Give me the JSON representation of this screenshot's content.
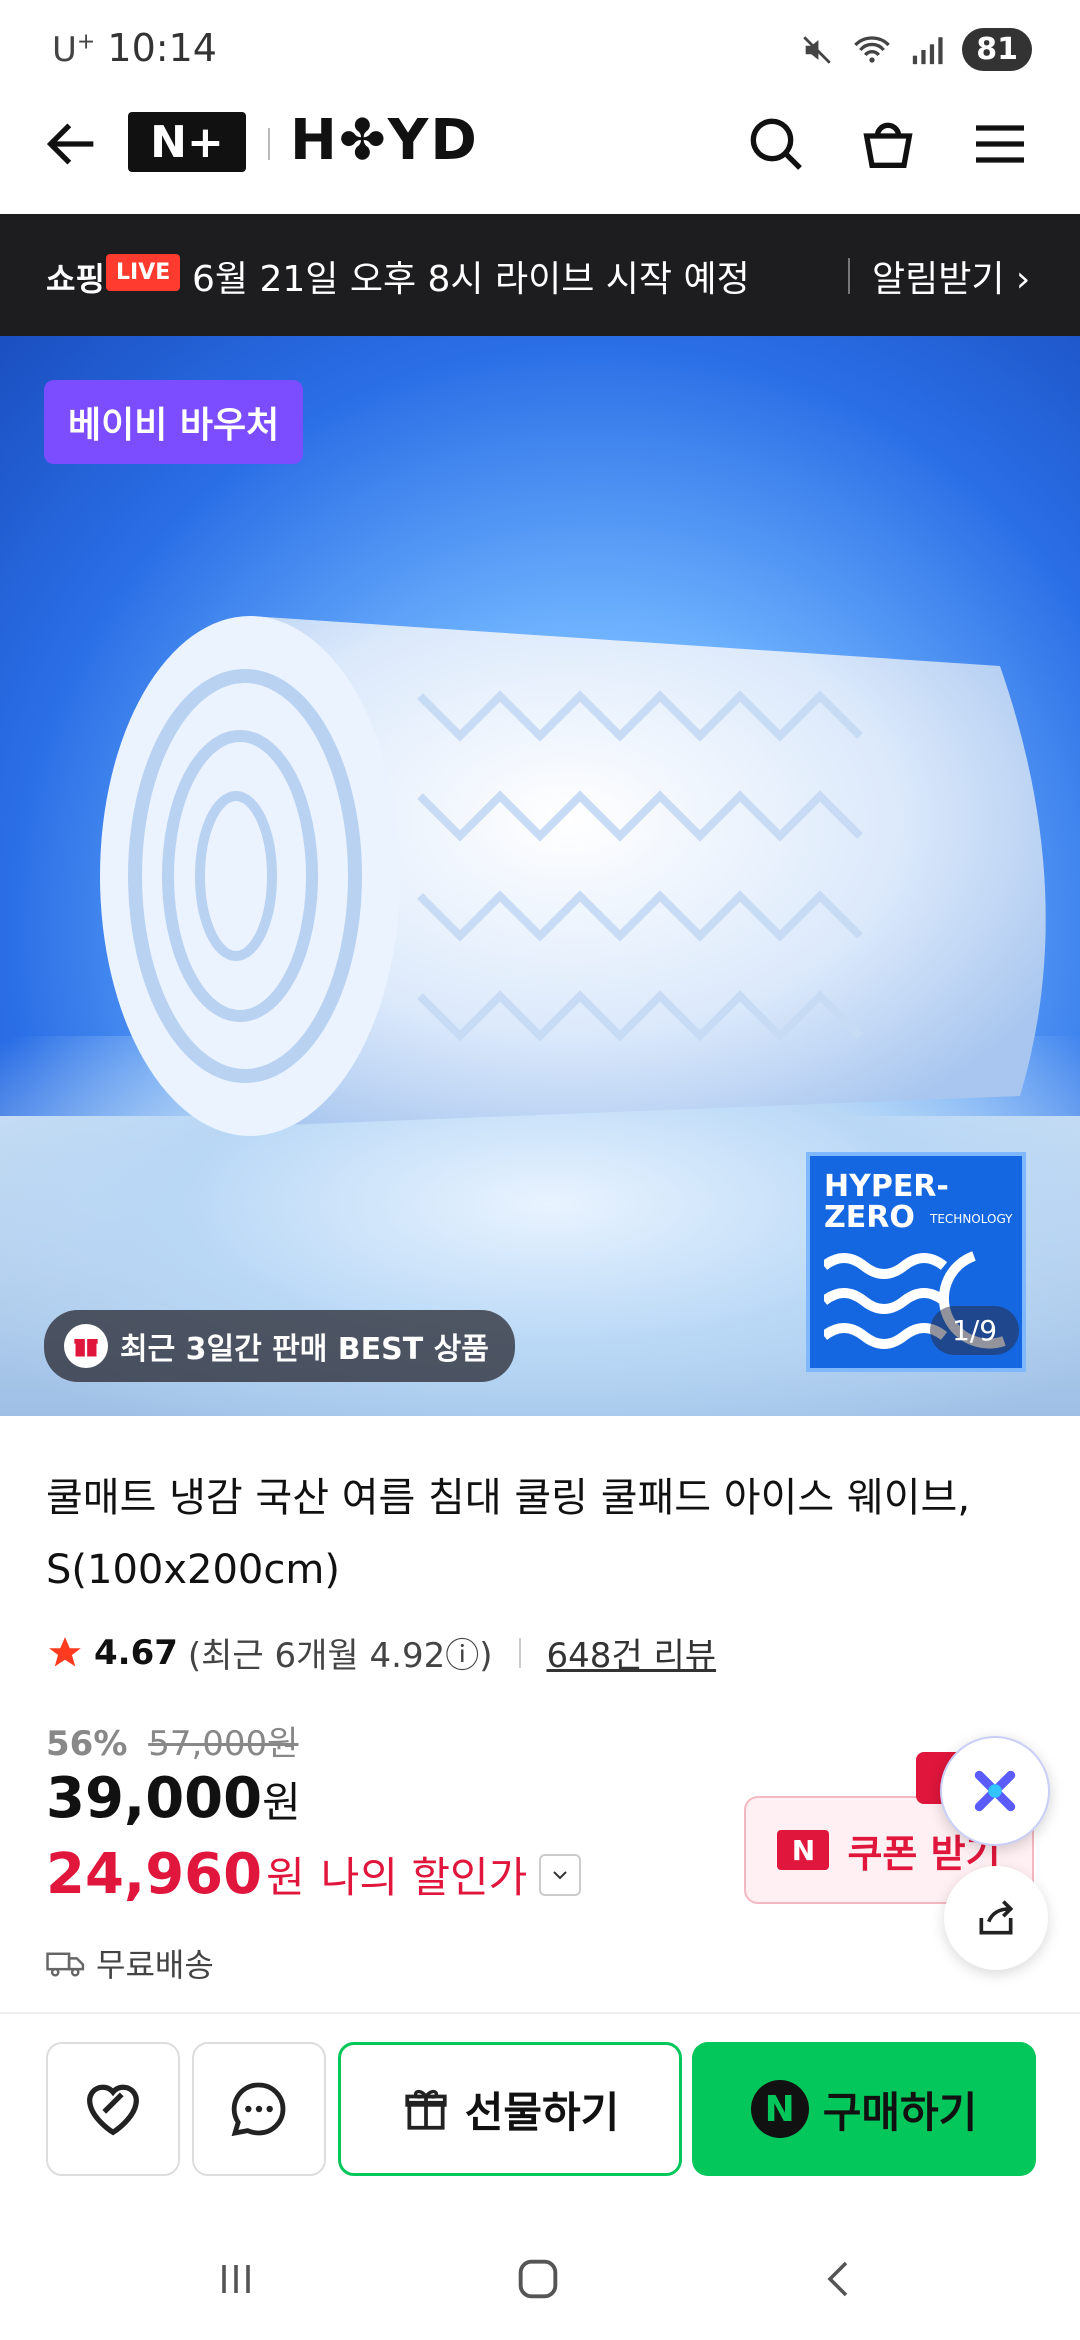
{
  "status": {
    "carrier": "U",
    "carrier_sup": "+",
    "time": "10:14",
    "battery": "81"
  },
  "header": {
    "logo_nplus": "N+",
    "brand": "H✤YD"
  },
  "live": {
    "shop": "쇼핑",
    "badge": "LIVE",
    "text": "6월 21일 오후 8시 라이브 시작 예정",
    "alarm": "알림받기 ›"
  },
  "hero": {
    "voucher": "베이비 바우처",
    "best": "최근 3일간 판매 BEST 상품",
    "hyper_line1": "HYPER-",
    "hyper_line2": "ZERO",
    "hyper_tech": "TECHNOLOGY",
    "counter": "1/9"
  },
  "product": {
    "title": "쿨매트 냉감 국산 여름 침대 쿨링 쿨패드 아이스 웨이브, S(100x200cm)",
    "rating_score": "4.67",
    "rating_recent": "(최근 6개월 4.92ⓘ)",
    "reviews": "648건 리뷰",
    "discount_pct": "56%",
    "original_price": "57,000원",
    "price": "39,000",
    "price_unit": "원",
    "my_price": "24,960",
    "my_price_unit": "원",
    "my_price_label": "나의 할인가",
    "shipping": "무료배송",
    "coupon_badge": "N",
    "coupon": "쿠폰 받기"
  },
  "bottom": {
    "gift": "선물하기",
    "buy_badge": "N",
    "buy": "구매하기"
  },
  "colors": {
    "accent_green": "#03c75a",
    "accent_red": "#e0163c",
    "voucher_purple": "#7b4dff"
  }
}
